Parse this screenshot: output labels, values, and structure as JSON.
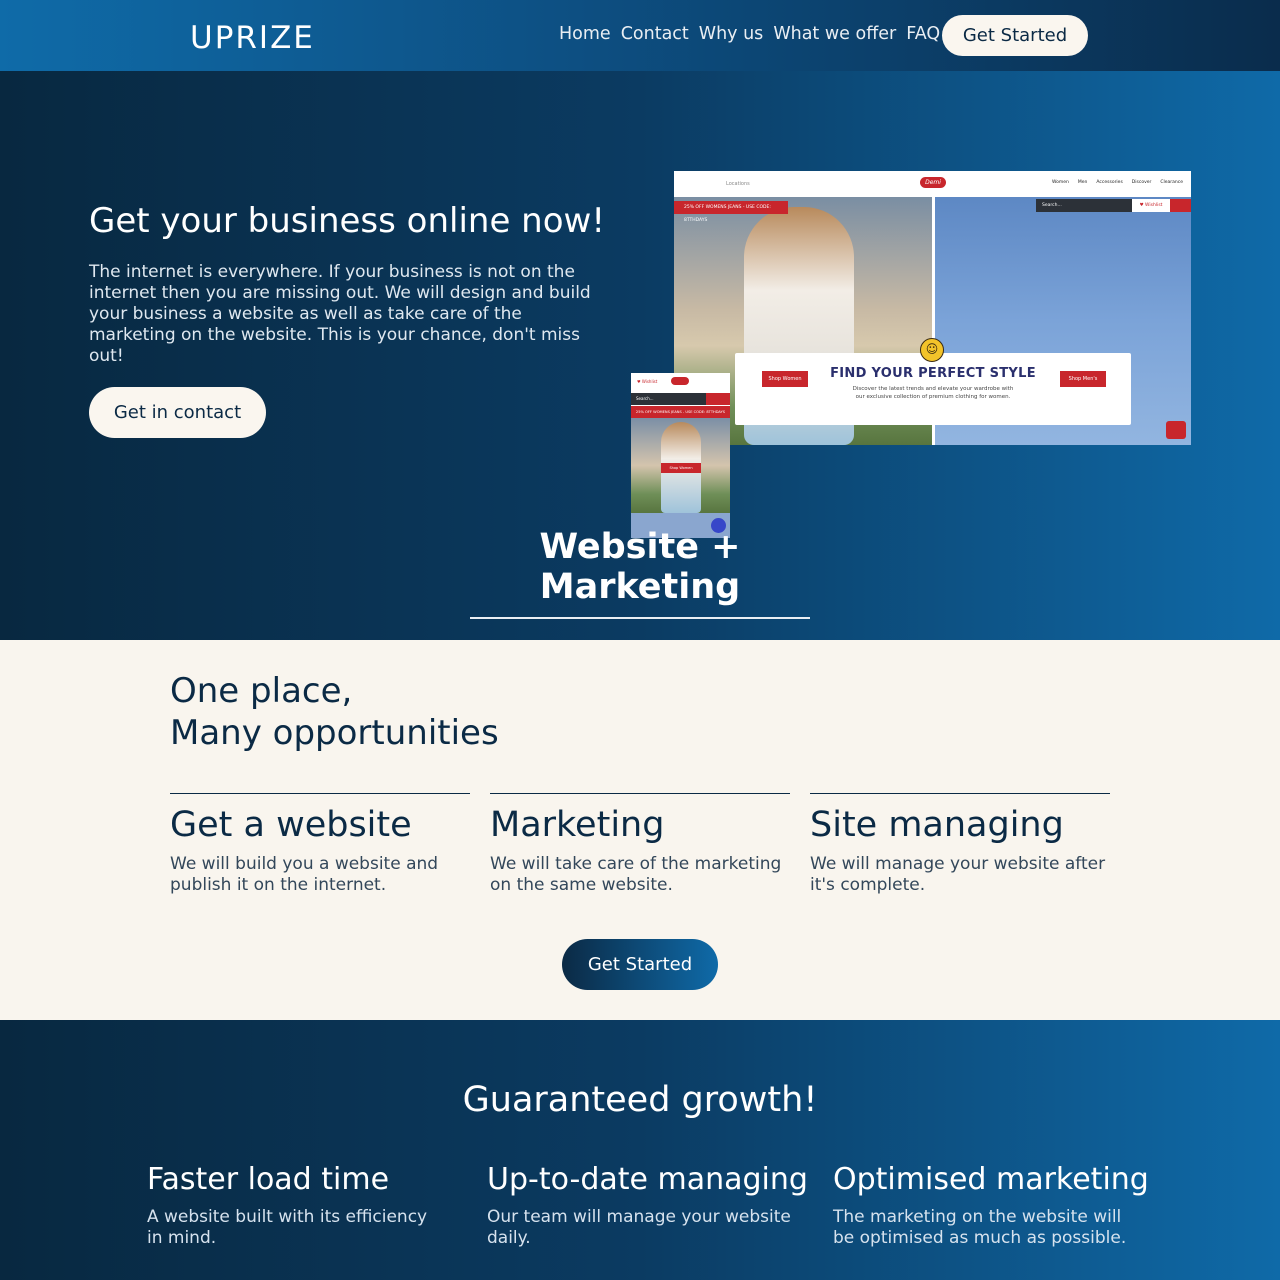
{
  "brand": {
    "logo": "UPRIZE"
  },
  "nav": {
    "links": [
      "Home",
      "Contact",
      "Why us",
      "What we offer",
      "FAQ"
    ],
    "cta": "Get Started"
  },
  "hero": {
    "title": "Get your business online now!",
    "text": "The internet is everywhere. If your business is not on the internet then you are missing out. We will design and build your business a website as well as take care of the marketing on the website. This is your chance, don't miss out!",
    "button": "Get in contact",
    "section_heading": "Website + Marketing"
  },
  "mockup": {
    "logo": "Demi",
    "location": "Locations",
    "menu": [
      "Women",
      "Men",
      "Accessories",
      "Discover",
      "Clearance"
    ],
    "promo": "25% OFF WOMENS JEANS - USE CODE: 8TTHDAYS",
    "search": "Search...",
    "wishlist": "♥ Wishlist",
    "card_title": "FIND YOUR PERFECT STYLE",
    "card_text": "Discover the latest trends and elevate your wardrobe with our exclusive collection of premium clothing for women.",
    "shop_women": "Shop Women",
    "shop_men": "Shop Men's",
    "phone_wishlist": "♥ Wishlist",
    "phone_search": "Search...",
    "phone_promo": "25% OFF WOMENS JEANS - USE CODE: 8TTHDAYS",
    "phone_shop": "Shop Women"
  },
  "opportunities": {
    "title_line1": "One place,",
    "title_line2": "Many opportunities",
    "features": [
      {
        "title": "Get a website",
        "text": "We will build you a website and publish it on the internet."
      },
      {
        "title": "Marketing",
        "text": "We will take care of the marketing on the same website."
      },
      {
        "title": "Site managing",
        "text": "We will manage your website after it's complete."
      }
    ],
    "button": "Get Started"
  },
  "growth": {
    "title": "Guaranteed growth!",
    "items": [
      {
        "title": "Faster load time",
        "text": "A website built with its efficiency in mind."
      },
      {
        "title": "Up-to-date managing",
        "text": "Our team will manage your website daily."
      },
      {
        "title": "Optimised marketing",
        "text": "The marketing on the website will be optimised as much as possible."
      }
    ]
  },
  "colors": {
    "dark_navy": "#0b2a45",
    "accent_blue": "#0f6aa8",
    "cream": "#f9f5ee",
    "shop_red": "#c8262c"
  }
}
